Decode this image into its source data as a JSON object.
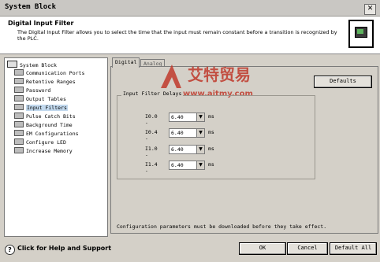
{
  "window": {
    "title": "System Block",
    "close_glyph": "✕"
  },
  "header": {
    "heading": "Digital Input Filter",
    "description": "The Digital Input Filter allows you to select the time that the input must remain constant before a transition is recognized by the PLC."
  },
  "tree": {
    "root": "System Block",
    "items": [
      {
        "label": "Communication Ports"
      },
      {
        "label": "Retentive Ranges"
      },
      {
        "label": "Password"
      },
      {
        "label": "Output Tables"
      },
      {
        "label": "Input Filters",
        "selected": true
      },
      {
        "label": "Pulse Catch Bits"
      },
      {
        "label": "Background Time"
      },
      {
        "label": "EM Configurations"
      },
      {
        "label": "Configure LED"
      },
      {
        "label": "Increase Memory"
      }
    ]
  },
  "tabs": [
    {
      "label": "Digital",
      "active": true
    },
    {
      "label": "Analog",
      "active": false
    }
  ],
  "defaults_button": "Defaults",
  "filter_group": {
    "label": "Input Filter Delays",
    "rows": [
      {
        "input": "I0.0 -",
        "value": "6.40",
        "unit": "ms"
      },
      {
        "input": "I0.4 -",
        "value": "6.40",
        "unit": "ms"
      },
      {
        "input": "I1.0 -",
        "value": "6.40",
        "unit": "ms"
      },
      {
        "input": "I1.4 -",
        "value": "6.40",
        "unit": "ms"
      }
    ]
  },
  "note": "Configuration parameters must be downloaded before they take effect.",
  "help_link": "Click for Help and Support",
  "buttons": {
    "ok": "OK",
    "cancel": "Cancel",
    "default_all": "Default All"
  },
  "watermark": {
    "logo_text": "艾特贸易",
    "url": "www.aitmy.com"
  },
  "icons": {
    "close": "close-icon",
    "folder": "module-icon",
    "combo_arrow": "chevron-down-icon",
    "help": "help-icon",
    "plc": "plc-chip-icon"
  }
}
